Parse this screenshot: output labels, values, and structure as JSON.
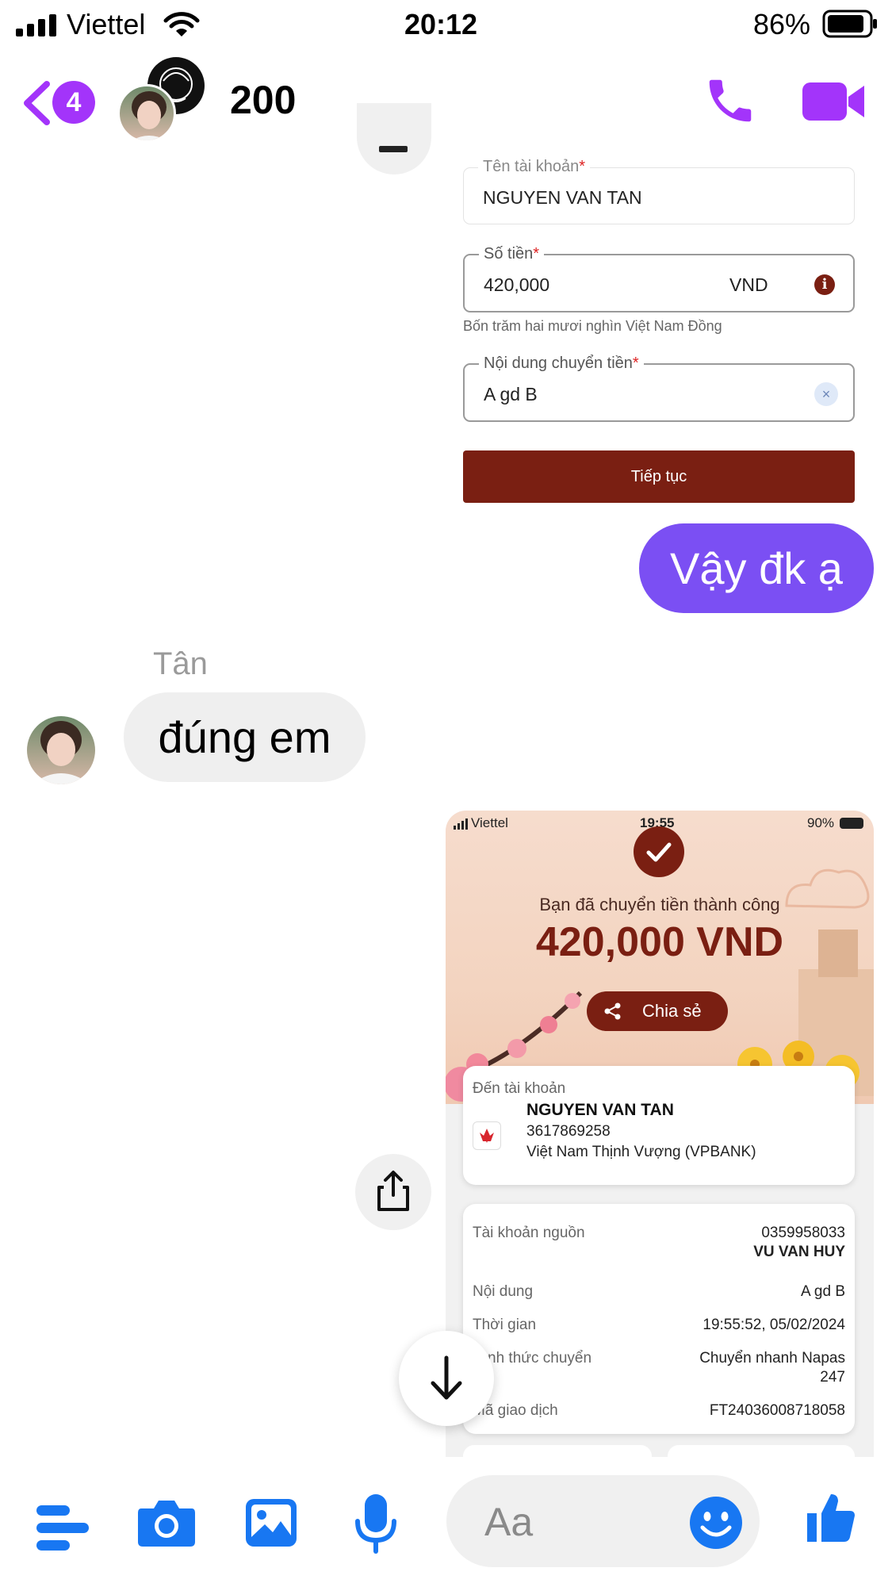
{
  "status_bar": {
    "carrier": "Viettel",
    "time": "20:12",
    "battery": "86%"
  },
  "header": {
    "unread_count": "4",
    "title": "200"
  },
  "transfer_form": {
    "account_name_label": "Tên tài khoản",
    "account_name_value": "NGUYEN VAN TAN",
    "amount_label": "Số tiền",
    "amount_value": "420,000",
    "currency": "VND",
    "amount_words": "Bốn trăm hai mươi nghìn Việt Nam Đồng",
    "content_label": "Nội dung chuyển tiền",
    "content_value": "A gd B",
    "continue_button": "Tiếp tục"
  },
  "messages": {
    "outgoing_1": "Vậy đk ạ",
    "sender_name": "Tân",
    "incoming_1": "đúng em"
  },
  "receipt": {
    "status_carrier": "Viettel",
    "status_time": "19:55",
    "status_battery": "90%",
    "success_text": "Bạn đã chuyển tiền thành công",
    "amount": "420,000 VND",
    "share_label": "Chia sẻ",
    "to_account_label": "Đến tài khoản",
    "recipient_name": "NGUYEN VAN TAN",
    "recipient_account": "3617869258",
    "recipient_bank": "Việt Nam Thịnh Vượng (VPBANK)",
    "source_label": "Tài khoản nguồn",
    "source_account": "0359958033",
    "source_name": "VU VAN HUY",
    "content_label": "Nội dung",
    "content_value": "A gd B",
    "time_label": "Thời gian",
    "time_value": "19:55:52, 05/02/2024",
    "method_label": "Hình thức chuyển",
    "method_value_line1": "Chuyển nhanh Napas",
    "method_value_line2": "247",
    "txn_label": "Mã giao dịch",
    "txn_value": "FT24036008718058"
  },
  "composer": {
    "placeholder": "Aa"
  },
  "colors": {
    "accent_purple": "#a334fa",
    "bubble_purple": "#7b4ff3",
    "messenger_blue": "#1877f2",
    "brand_dark_red": "#7a1f12"
  }
}
